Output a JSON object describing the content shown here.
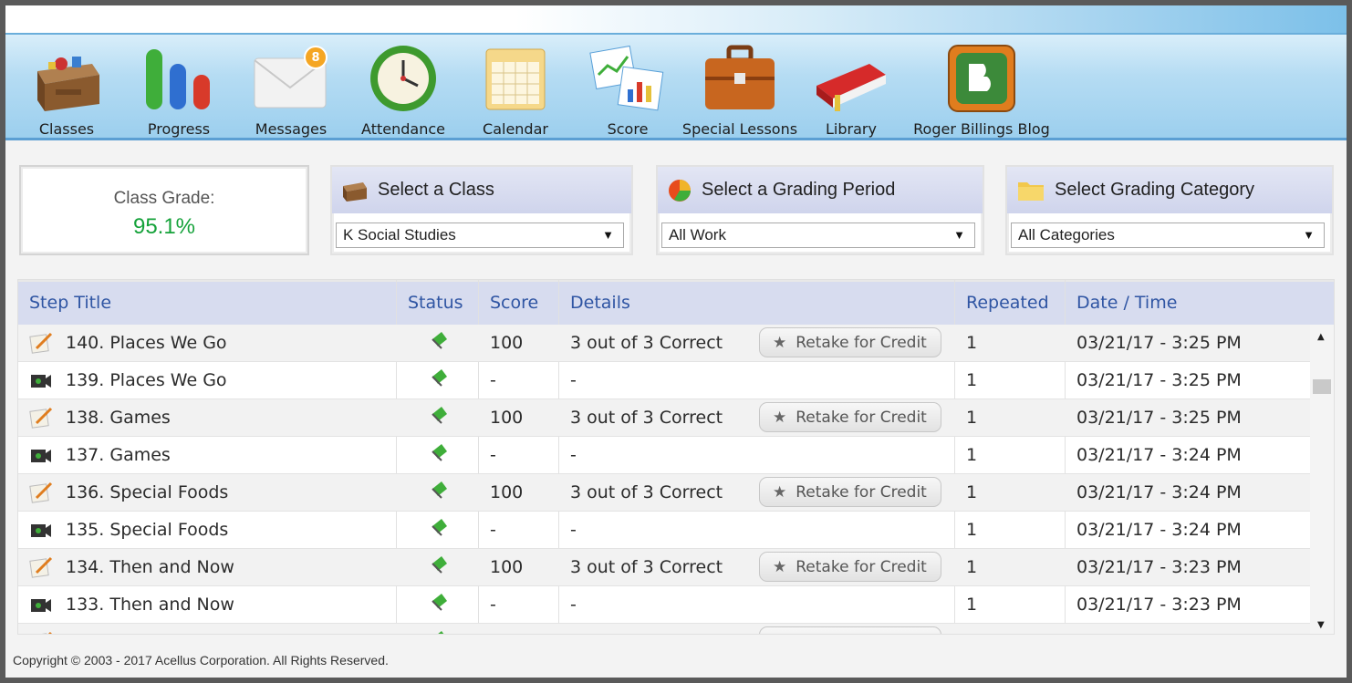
{
  "nav": {
    "items": [
      {
        "label": "Classes",
        "icon": "desk-icon"
      },
      {
        "label": "Progress",
        "icon": "progress-bars-icon"
      },
      {
        "label": "Messages",
        "icon": "envelope-icon",
        "badge": "8"
      },
      {
        "label": "Attendance",
        "icon": "clock-icon"
      },
      {
        "label": "Calendar",
        "icon": "calendar-icon"
      },
      {
        "label": "Score",
        "icon": "score-charts-icon"
      },
      {
        "label": "Special Lessons",
        "icon": "briefcase-icon"
      },
      {
        "label": "Library",
        "icon": "book-icon"
      },
      {
        "label": "Roger Billings Blog",
        "icon": "blogger-icon"
      }
    ]
  },
  "grade": {
    "label": "Class Grade:",
    "value": "95.1%"
  },
  "selects": {
    "class": {
      "title": "Select a Class",
      "value": "K Social Studies"
    },
    "period": {
      "title": "Select a Grading Period",
      "value": "All Work"
    },
    "category": {
      "title": "Select Grading Category",
      "value": "All Categories"
    }
  },
  "table": {
    "headers": {
      "step": "Step Title",
      "status": "Status",
      "score": "Score",
      "details": "Details",
      "repeated": "Repeated",
      "datetime": "Date / Time"
    },
    "retake_label": "Retake for Credit",
    "rows": [
      {
        "title": "140. Places We Go",
        "score": "100",
        "details": "3 out of 3 Correct",
        "repeated": "1",
        "datetime": "03/21/17 - 3:25 PM"
      },
      {
        "title": "139. Places We Go",
        "score": "-",
        "details": "-",
        "repeated": "1",
        "datetime": "03/21/17 - 3:25 PM"
      },
      {
        "title": "138. Games",
        "score": "100",
        "details": "3 out of 3 Correct",
        "repeated": "1",
        "datetime": "03/21/17 - 3:25 PM"
      },
      {
        "title": "137. Games",
        "score": "-",
        "details": "-",
        "repeated": "1",
        "datetime": "03/21/17 - 3:24 PM"
      },
      {
        "title": "136. Special Foods",
        "score": "100",
        "details": "3 out of 3 Correct",
        "repeated": "1",
        "datetime": "03/21/17 - 3:24 PM"
      },
      {
        "title": "135. Special Foods",
        "score": "-",
        "details": "-",
        "repeated": "1",
        "datetime": "03/21/17 - 3:24 PM"
      },
      {
        "title": "134. Then and Now",
        "score": "100",
        "details": "3 out of 3 Correct",
        "repeated": "1",
        "datetime": "03/21/17 - 3:23 PM"
      },
      {
        "title": "133. Then and Now",
        "score": "-",
        "details": "-",
        "repeated": "1",
        "datetime": "03/21/17 - 3:23 PM"
      }
    ]
  },
  "footer": {
    "copyright": "Copyright © 2003 - 2017 Acellus Corporation.  All Rights Reserved."
  },
  "colors": {
    "accent": "#2f55a3",
    "grade": "#15a23a",
    "navbar": "#9ccfee"
  }
}
